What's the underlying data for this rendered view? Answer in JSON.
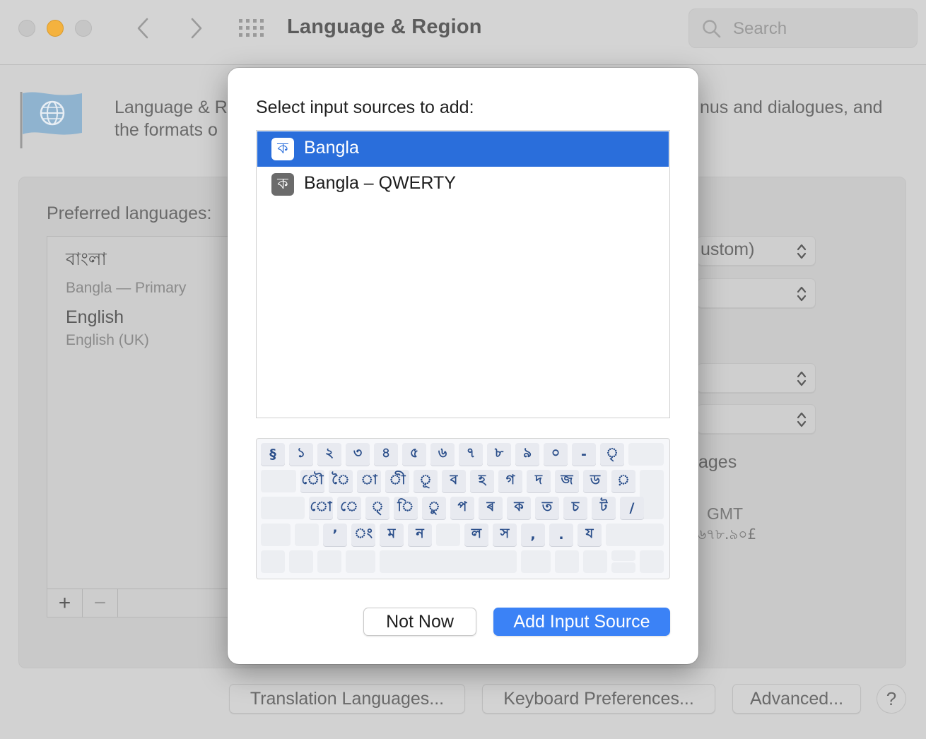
{
  "window": {
    "title": "Language & Region",
    "search_placeholder": "Search"
  },
  "header": {
    "desc_left_line1": "Language & R",
    "desc_left_line2": "the formats o",
    "desc_right_line1": "nus and dialogues, and"
  },
  "preferred": {
    "label": "Preferred languages:",
    "languages": [
      {
        "name": "বাংলা",
        "sub": "Bangla — Primary"
      },
      {
        "name": "English",
        "sub": "English (UK)"
      }
    ],
    "add": "+",
    "remove": "−"
  },
  "right_panel": {
    "popup1": "ustom)",
    "popup2": "",
    "popup3": "",
    "popup4": "",
    "text_ages": "ages",
    "text_gmt": "GMT",
    "text_currency": "৬৭৮.৯০£"
  },
  "bottom_buttons": {
    "translation": "Translation Languages...",
    "keyboard": "Keyboard Preferences...",
    "advanced": "Advanced...",
    "help": "?"
  },
  "sheet": {
    "title": "Select input sources to add:",
    "sources": [
      {
        "label": "Bangla",
        "glyph": "ক",
        "selected": true
      },
      {
        "label": "Bangla – QWERTY",
        "glyph": "ক",
        "selected": false
      }
    ],
    "keyboard": {
      "row1": [
        "§",
        "১",
        "২",
        "৩",
        "৪",
        "৫",
        "৬",
        "৭",
        "৮",
        "৯",
        "০",
        "-",
        "ৃ"
      ],
      "row2": [
        "ৌ",
        "ৈ",
        "া",
        "ী",
        "ূ",
        "ব",
        "হ",
        "গ",
        "দ",
        "জ",
        "ড",
        "়"
      ],
      "row3": [
        "ো",
        "ে",
        "্",
        "ি",
        "ু",
        "প",
        "ৰ",
        "ক",
        "ত",
        "চ",
        "ট",
        "/"
      ],
      "row4": [
        "’",
        "ং",
        "ম",
        "ন",
        "",
        "ল",
        "স",
        ",",
        ".",
        "য"
      ]
    },
    "not_now": "Not Now",
    "add": "Add Input Source"
  },
  "colors": {
    "selection": "#2a6edb",
    "primary_button": "#3b82f6",
    "key_text": "#2a4e8a"
  }
}
